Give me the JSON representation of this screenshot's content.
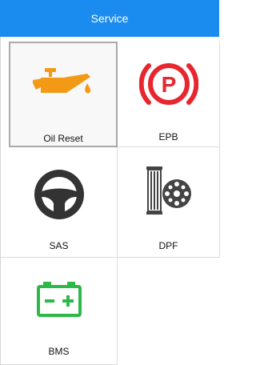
{
  "header": {
    "title": "Service"
  },
  "tiles": [
    {
      "label": "Oil Reset",
      "icon": "oil-can-icon",
      "selected": true
    },
    {
      "label": "EPB",
      "icon": "parking-brake-icon"
    },
    {
      "label": "SAS",
      "icon": "steering-wheel-icon"
    },
    {
      "label": "DPF",
      "icon": "diesel-particulate-filter-icon"
    },
    {
      "label": "BMS",
      "icon": "battery-icon"
    }
  ],
  "colors": {
    "header": "#1a8cf0",
    "oil": "#f29a16",
    "epb": "#e8262e",
    "battery": "#2fb84a",
    "dark_icon": "#333333"
  }
}
